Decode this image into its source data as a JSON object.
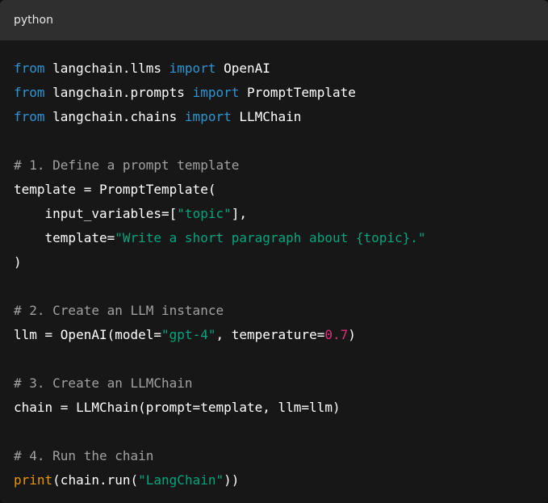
{
  "code_block": {
    "language": "python",
    "lines": [
      [
        {
          "t": "from",
          "c": "kw"
        },
        {
          "t": " langchain.llms ",
          "c": "tx"
        },
        {
          "t": "import",
          "c": "kw"
        },
        {
          "t": " OpenAI",
          "c": "tx"
        }
      ],
      [
        {
          "t": "from",
          "c": "kw"
        },
        {
          "t": " langchain.prompts ",
          "c": "tx"
        },
        {
          "t": "import",
          "c": "kw"
        },
        {
          "t": " PromptTemplate",
          "c": "tx"
        }
      ],
      [
        {
          "t": "from",
          "c": "kw"
        },
        {
          "t": " langchain.chains ",
          "c": "tx"
        },
        {
          "t": "import",
          "c": "kw"
        },
        {
          "t": " LLMChain",
          "c": "tx"
        }
      ],
      [],
      [
        {
          "t": "# 1. Define a prompt template",
          "c": "cm"
        }
      ],
      [
        {
          "t": "template = PromptTemplate(",
          "c": "tx"
        }
      ],
      [
        {
          "t": "    input_variables=[",
          "c": "tx"
        },
        {
          "t": "\"topic\"",
          "c": "st"
        },
        {
          "t": "],",
          "c": "tx"
        }
      ],
      [
        {
          "t": "    template=",
          "c": "tx"
        },
        {
          "t": "\"Write a short paragraph about {topic}.\"",
          "c": "st"
        }
      ],
      [
        {
          "t": ")",
          "c": "tx"
        }
      ],
      [],
      [
        {
          "t": "# 2. Create an LLM instance",
          "c": "cm"
        }
      ],
      [
        {
          "t": "llm = OpenAI(model=",
          "c": "tx"
        },
        {
          "t": "\"gpt-4\"",
          "c": "st"
        },
        {
          "t": ", temperature=",
          "c": "tx"
        },
        {
          "t": "0.7",
          "c": "nm"
        },
        {
          "t": ")",
          "c": "tx"
        }
      ],
      [],
      [
        {
          "t": "# 3. Create an LLMChain",
          "c": "cm"
        }
      ],
      [
        {
          "t": "chain = LLMChain(prompt=template, llm=llm)",
          "c": "tx"
        }
      ],
      [],
      [
        {
          "t": "# 4. Run the chain",
          "c": "cm"
        }
      ],
      [
        {
          "t": "print",
          "c": "fn"
        },
        {
          "t": "(chain.run(",
          "c": "tx"
        },
        {
          "t": "\"LangChain\"",
          "c": "st"
        },
        {
          "t": "))",
          "c": "tx"
        }
      ]
    ]
  }
}
